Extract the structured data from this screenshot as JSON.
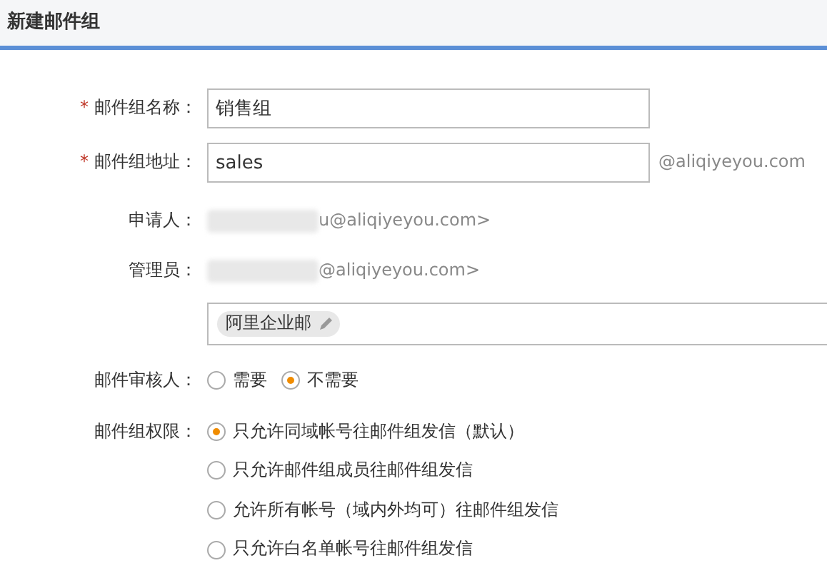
{
  "header": {
    "title": "新建邮件组"
  },
  "fields": [
    {
      "label": "邮件组名称：",
      "required": true,
      "value": "销售组"
    },
    {
      "label": "邮件组地址：",
      "required": true,
      "value": "sales",
      "suffix": "@aliqiyeyou.com"
    }
  ],
  "required_mark": "*",
  "applicant": {
    "label": "申请人：",
    "value": "u@aliqiyeyou.com>"
  },
  "admin": {
    "label": "管理员：",
    "value": "@aliqiyeyou.com>",
    "tags": [
      {
        "label": "阿里企业邮"
      }
    ]
  },
  "reviewer": {
    "label": "邮件审核人：",
    "options": [
      {
        "label": "需要",
        "selected": false
      },
      {
        "label": "不需要",
        "selected": true
      }
    ]
  },
  "permissions": {
    "label": "邮件组权限：",
    "options": [
      {
        "label": "只允许同域帐号往邮件组发信（默认）",
        "selected": true
      },
      {
        "label": "只允许邮件组成员往邮件组发信",
        "selected": false
      },
      {
        "label": "允许所有帐号（域内外均可）往邮件组发信",
        "selected": false
      },
      {
        "label": "只允许白名单帐号往邮件组发信",
        "selected": false
      }
    ]
  }
}
